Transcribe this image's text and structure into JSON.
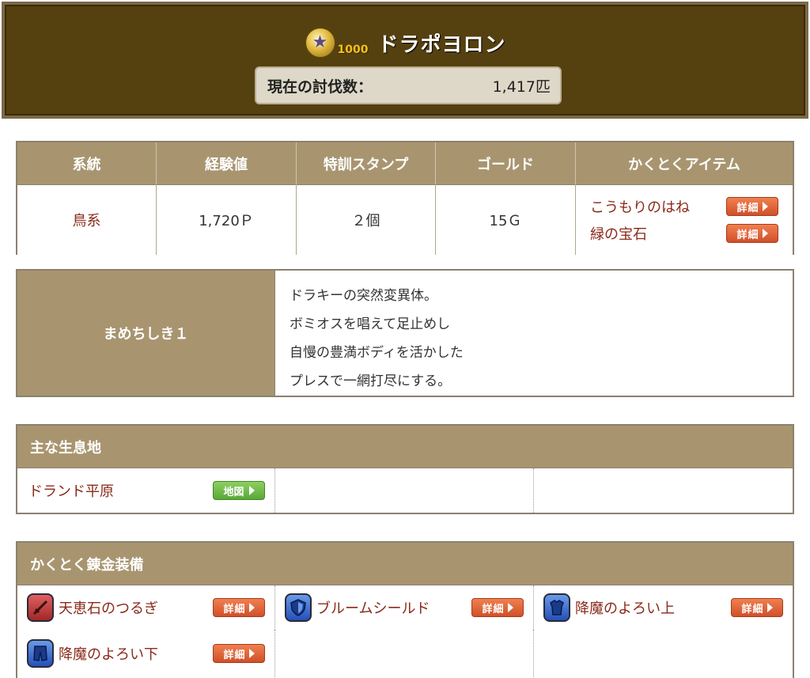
{
  "header": {
    "coin_value": "1000",
    "monster_name": "ドラポヨロン",
    "kill_label": "現在の討伐数：",
    "kill_count": "1,417匹"
  },
  "stats": {
    "headers": [
      "系統",
      "経験値",
      "特訓スタンプ",
      "ゴールド",
      "かくとくアイテム"
    ],
    "family": "鳥系",
    "exp": "1,720Ｐ",
    "stamp": "２個",
    "gold": "15Ｇ",
    "items": [
      {
        "name": "こうもりのはね",
        "button": "詳細"
      },
      {
        "name": "緑の宝石",
        "button": "詳細"
      }
    ]
  },
  "description": {
    "name": "まめちしき１",
    "lines": [
      "ドラキーの突然変異体。",
      "ボミオスを唱えて足止めし",
      "自慢の豊満ボディを活かした",
      "プレスで一網打尽にする。"
    ]
  },
  "habitat": {
    "title": "主な生息地",
    "places": [
      {
        "name": "ドランド平原",
        "button": "地図"
      }
    ]
  },
  "equipment": {
    "title": "かくとく錬金装備",
    "items": [
      {
        "name": "天恵石のつるぎ",
        "icon": "sword-icon",
        "button": "詳細"
      },
      {
        "name": "ブルームシールド",
        "icon": "shield-icon",
        "button": "詳細"
      },
      {
        "name": "降魔のよろい上",
        "icon": "armor-top-icon",
        "button": "詳細"
      },
      {
        "name": "降魔のよろい下",
        "icon": "armor-bottom-icon",
        "button": "詳細"
      }
    ]
  },
  "colors": {
    "header_bg": "#55400f",
    "section_header": "#a89570",
    "link_red": "#8a2a1a",
    "detail_button": "#d0502a",
    "map_button": "#5aa838"
  }
}
